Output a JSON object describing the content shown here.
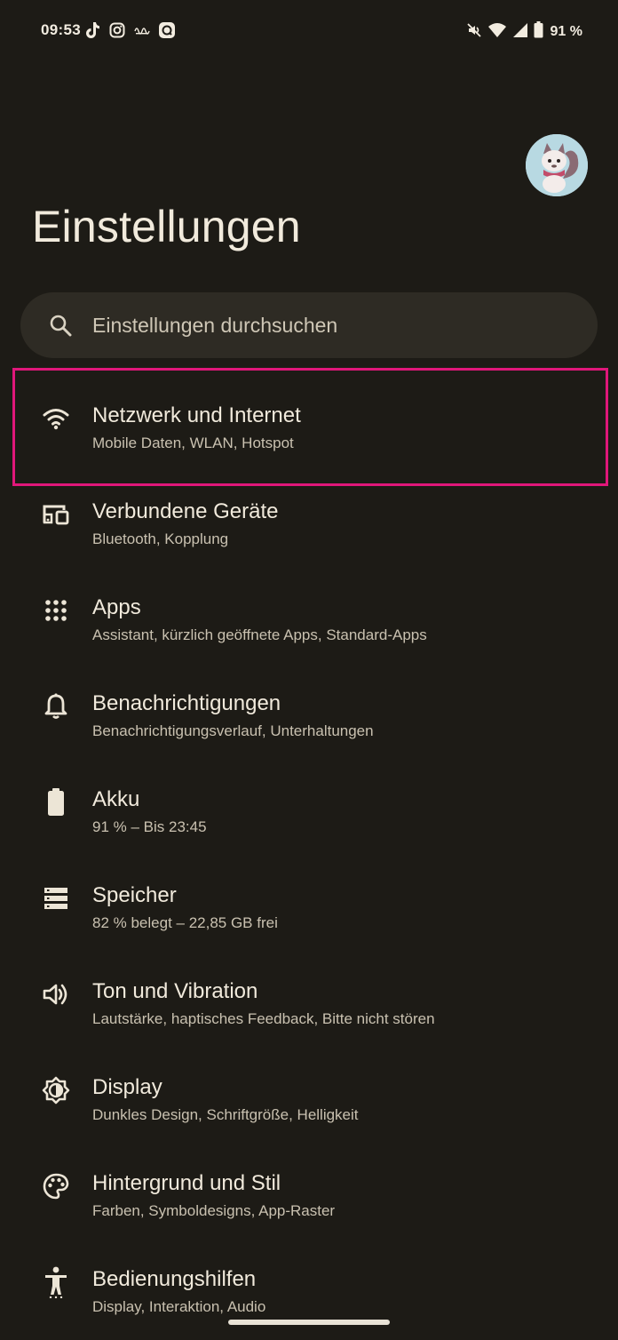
{
  "status_bar": {
    "time": "09:53",
    "battery": "91 %",
    "left_icons": [
      "tiktok-icon",
      "instagram-icon",
      "app-icon",
      "app2-icon"
    ],
    "right_icons": [
      "mute-icon",
      "wifi-icon",
      "signal-icon",
      "battery-icon"
    ]
  },
  "header": {
    "title": "Einstellungen"
  },
  "search": {
    "placeholder": "Einstellungen durchsuchen"
  },
  "highlight_color": "#e0177a",
  "items": [
    {
      "icon": "wifi-icon",
      "title": "Netzwerk und Internet",
      "subtitle": "Mobile Daten, WLAN, Hotspot"
    },
    {
      "icon": "connected-devices-icon",
      "title": "Verbundene Geräte",
      "subtitle": "Bluetooth, Kopplung"
    },
    {
      "icon": "apps-grid-icon",
      "title": "Apps",
      "subtitle": "Assistant, kürzlich geöffnete Apps, Standard-Apps"
    },
    {
      "icon": "bell-icon",
      "title": "Benachrichtigungen",
      "subtitle": "Benachrichtigungsverlauf, Unterhaltungen"
    },
    {
      "icon": "battery-icon",
      "title": "Akku",
      "subtitle": "91 % – Bis 23:45"
    },
    {
      "icon": "storage-icon",
      "title": "Speicher",
      "subtitle": "82 % belegt – 22,85 GB frei"
    },
    {
      "icon": "volume-icon",
      "title": "Ton und Vibration",
      "subtitle": "Lautstärke, haptisches Feedback, Bitte nicht stören"
    },
    {
      "icon": "display-icon",
      "title": "Display",
      "subtitle": "Dunkles Design, Schriftgröße, Helligkeit"
    },
    {
      "icon": "palette-icon",
      "title": "Hintergrund und Stil",
      "subtitle": "Farben, Symboldesigns, App-Raster"
    },
    {
      "icon": "accessibility-icon",
      "title": "Bedienungshilfen",
      "subtitle": "Display, Interaktion, Audio"
    }
  ]
}
